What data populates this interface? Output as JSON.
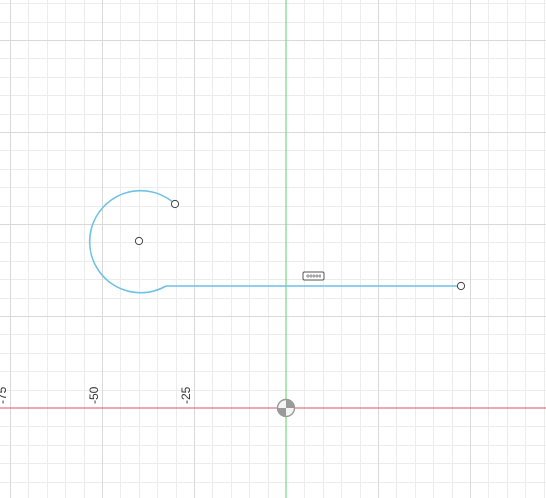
{
  "viewport": {
    "background": "#ffffff",
    "minor_grid_color": "#ececec",
    "major_grid_color": "#d9d9d9",
    "x_axis_color": "#d9536b",
    "y_axis_color": "#5fcf6a",
    "sketch_color": "#6cc1e6"
  },
  "axis_labels": {
    "x_ticks": [
      "-75",
      "-50",
      "-25"
    ]
  },
  "origin_marker": {
    "icon": "origin-icon"
  },
  "sketch": {
    "constraint_icon": "horizontal-constraint-icon"
  }
}
